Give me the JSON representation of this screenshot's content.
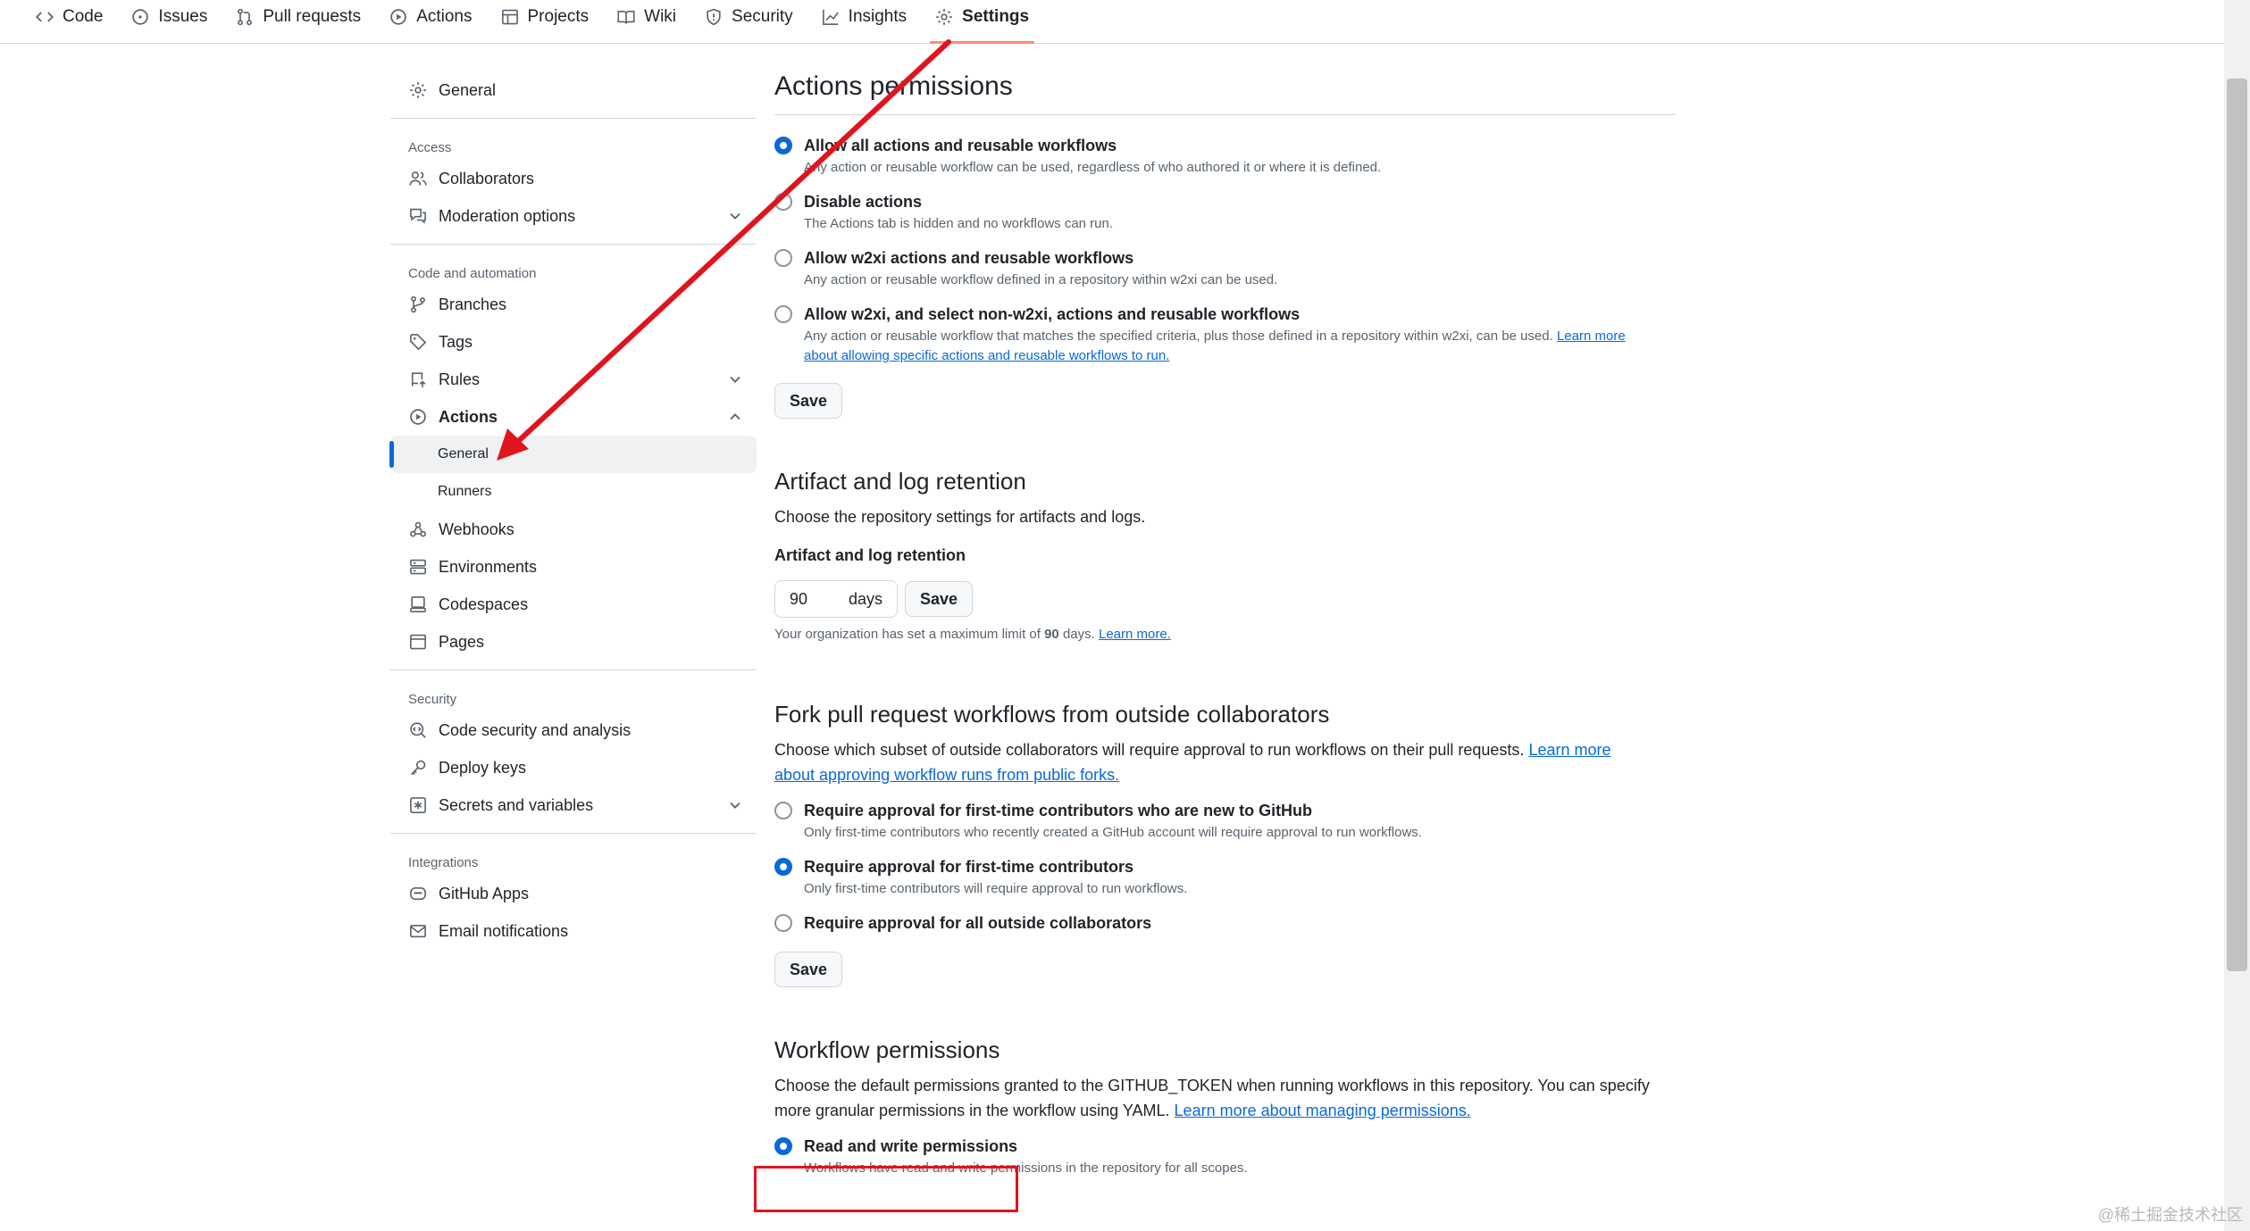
{
  "topnav": {
    "tabs": [
      {
        "label": "Code",
        "icon": "code-icon"
      },
      {
        "label": "Issues",
        "icon": "issue-opened-icon"
      },
      {
        "label": "Pull requests",
        "icon": "git-pull-request-icon"
      },
      {
        "label": "Actions",
        "icon": "play-icon"
      },
      {
        "label": "Projects",
        "icon": "table-icon"
      },
      {
        "label": "Wiki",
        "icon": "book-icon"
      },
      {
        "label": "Security",
        "icon": "shield-icon"
      },
      {
        "label": "Insights",
        "icon": "graph-icon"
      },
      {
        "label": "Settings",
        "icon": "gear-icon",
        "selected": true
      }
    ]
  },
  "sidebar": {
    "general": "General",
    "access_head": "Access",
    "collaborators": "Collaborators",
    "moderation": "Moderation options",
    "code_head": "Code and automation",
    "branches": "Branches",
    "tags": "Tags",
    "rules": "Rules",
    "actions": "Actions",
    "actions_general": "General",
    "actions_runners": "Runners",
    "webhooks": "Webhooks",
    "environments": "Environments",
    "codespaces": "Codespaces",
    "pages": "Pages",
    "security_head": "Security",
    "code_security": "Code security and analysis",
    "deploy_keys": "Deploy keys",
    "secrets": "Secrets and variables",
    "integrations_head": "Integrations",
    "github_apps": "GitHub Apps",
    "email_notifications": "Email notifications"
  },
  "actions_permissions": {
    "title": "Actions permissions",
    "options": [
      {
        "label": "Allow all actions and reusable workflows",
        "desc": "Any action or reusable workflow can be used, regardless of who authored it or where it is defined.",
        "checked": true
      },
      {
        "label": "Disable actions",
        "desc": "The Actions tab is hidden and no workflows can run.",
        "checked": false
      },
      {
        "label": "Allow w2xi actions and reusable workflows",
        "desc": "Any action or reusable workflow defined in a repository within w2xi can be used.",
        "checked": false
      },
      {
        "label": "Allow w2xi, and select non-w2xi, actions and reusable workflows",
        "desc": "Any action or reusable workflow that matches the specified criteria, plus those defined in a repository within w2xi, can be used.",
        "checked": false
      }
    ],
    "learn_more_1": "Learn more",
    "learn_more_2": "about allowing specific actions and reusable workflows to run.",
    "save": "Save"
  },
  "artifact": {
    "title": "Artifact and log retention",
    "desc": "Choose the repository settings for artifacts and logs.",
    "field_label": "Artifact and log retention",
    "value": "90",
    "unit": "days",
    "save": "Save",
    "note_prefix": "Your organization has set a maximum limit of",
    "note_value": "90",
    "note_suffix": "days.",
    "note_link": "Learn more."
  },
  "fork": {
    "title": "Fork pull request workflows from outside collaborators",
    "desc": "Choose which subset of outside collaborators will require approval to run workflows on their pull requests.",
    "link_1": "Learn more",
    "link_2": "about approving workflow runs from public forks.",
    "options": [
      {
        "label": "Require approval for first-time contributors who are new to GitHub",
        "desc": "Only first-time contributors who recently created a GitHub account will require approval to run workflows.",
        "checked": false
      },
      {
        "label": "Require approval for first-time contributors",
        "desc": "Only first-time contributors will require approval to run workflows.",
        "checked": true
      },
      {
        "label": "Require approval for all outside collaborators",
        "desc": "",
        "checked": false
      }
    ],
    "save": "Save"
  },
  "workflow": {
    "title": "Workflow permissions",
    "desc_1": "Choose the default permissions granted to the GITHUB_TOKEN when running workflows in this repository. You can specify",
    "desc_2": "more granular permissions in the workflow using YAML.",
    "link": "Learn more about managing permissions.",
    "option_label": "Read and write permissions",
    "option_desc": "Workflows have read and write permissions in the repository for all scopes."
  },
  "watermark": "@稀土掘金技术社区",
  "colors": {
    "accent": "#0969da",
    "selected_tab": "#fd8c73",
    "annotation": "#e0141e"
  }
}
